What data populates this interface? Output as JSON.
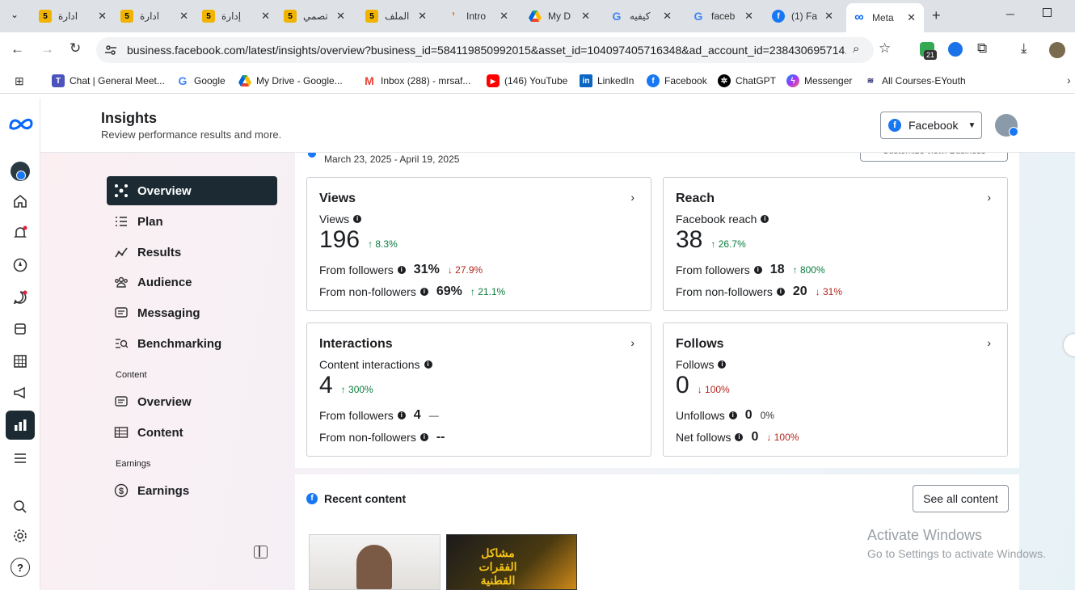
{
  "browser": {
    "tabs": [
      {
        "label": "ادارة",
        "fav": "5",
        "color": "#f0b400"
      },
      {
        "label": "ادارة",
        "fav": "5",
        "color": "#f0b400"
      },
      {
        "label": "إدارة",
        "fav": "5",
        "color": "#f0b400"
      },
      {
        "label": "تصمي",
        "fav": "5",
        "color": "#f0b400"
      },
      {
        "label": "الملف",
        "fav": "5",
        "color": "#f0b400"
      },
      {
        "label": "Intro",
        "fav": "ʼ",
        "color": "#e8710a"
      },
      {
        "label": "My D",
        "fav": "▲",
        "color": "#1fa463"
      },
      {
        "label": "كيفيه",
        "fav": "G",
        "color": "#4285f4"
      },
      {
        "label": "faceb",
        "fav": "G",
        "color": "#4285f4"
      },
      {
        "label": "(1) Fa",
        "fav": "f",
        "color": "#1877f2"
      },
      {
        "label": "Meta",
        "fav": "∞",
        "color": "#0866ff"
      }
    ],
    "url": "business.facebook.com/latest/insights/overview?business_id=584119850992015&asset_id=104097405716348&ad_account_id=238430695714...",
    "extension_badge": "21",
    "bookmarks": [
      {
        "label": "Chat | General Meet..."
      },
      {
        "label": "Google"
      },
      {
        "label": "My Drive - Google..."
      },
      {
        "label": "Inbox (288) - mrsaf..."
      },
      {
        "label": "(146) YouTube"
      },
      {
        "label": "LinkedIn"
      },
      {
        "label": "Facebook"
      },
      {
        "label": "ChatGPT"
      },
      {
        "label": "Messenger"
      },
      {
        "label": "All Courses-EYouth"
      }
    ]
  },
  "header": {
    "title": "Insights",
    "subtitle": "Review performance results and more.",
    "platform_selector": "Facebook"
  },
  "date_range": "March 23, 2025 - April 19, 2025",
  "customize_button": "Customize view: Business",
  "nav": {
    "items": [
      {
        "label": "Overview",
        "icon": "overview-icon"
      },
      {
        "label": "Plan",
        "icon": "plan-icon"
      },
      {
        "label": "Results",
        "icon": "results-icon"
      },
      {
        "label": "Audience",
        "icon": "audience-icon"
      },
      {
        "label": "Messaging",
        "icon": "messaging-icon"
      },
      {
        "label": "Benchmarking",
        "icon": "benchmarking-icon"
      }
    ],
    "content_section": "Content",
    "content_items": [
      {
        "label": "Overview",
        "icon": "content-overview-icon"
      },
      {
        "label": "Content",
        "icon": "content-table-icon"
      }
    ],
    "earnings_section": "Earnings",
    "earnings_items": [
      {
        "label": "Earnings",
        "icon": "dollar-icon"
      }
    ]
  },
  "cards": {
    "views": {
      "title": "Views",
      "metric": "Views",
      "value": "196",
      "change": "8.3%",
      "row1_label": "From followers",
      "row1_value": "31%",
      "row1_change": "27.9%",
      "row2_label": "From non-followers",
      "row2_value": "69%",
      "row2_change": "21.1%"
    },
    "reach": {
      "title": "Reach",
      "metric": "Facebook reach",
      "value": "38",
      "change": "26.7%",
      "row1_label": "From followers",
      "row1_value": "18",
      "row1_change": "800%",
      "row2_label": "From non-followers",
      "row2_value": "20",
      "row2_change": "31%"
    },
    "interactions": {
      "title": "Interactions",
      "metric": "Content interactions",
      "value": "4",
      "change": "300%",
      "row1_label": "From followers",
      "row1_value": "4",
      "row1_change": "—",
      "row2_label": "From non-followers",
      "row2_value": "--"
    },
    "follows": {
      "title": "Follows",
      "metric": "Follows",
      "value": "0",
      "change": "100%",
      "row1_label": "Unfollows",
      "row1_value": "0",
      "row1_change": "0%",
      "row2_label": "Net follows",
      "row2_value": "0",
      "row2_change": "100%"
    }
  },
  "recent": {
    "title": "Recent content",
    "see_all": "See all content",
    "thumb_text": "مشاكل الفقرات القطنية"
  },
  "watermark": {
    "line1": "Activate Windows",
    "line2": "Go to Settings to activate Windows."
  },
  "colors": {
    "accent": "#1877f2",
    "up": "#0a7d3e",
    "down": "#b3261e",
    "nav_active": "#1c2b33"
  }
}
